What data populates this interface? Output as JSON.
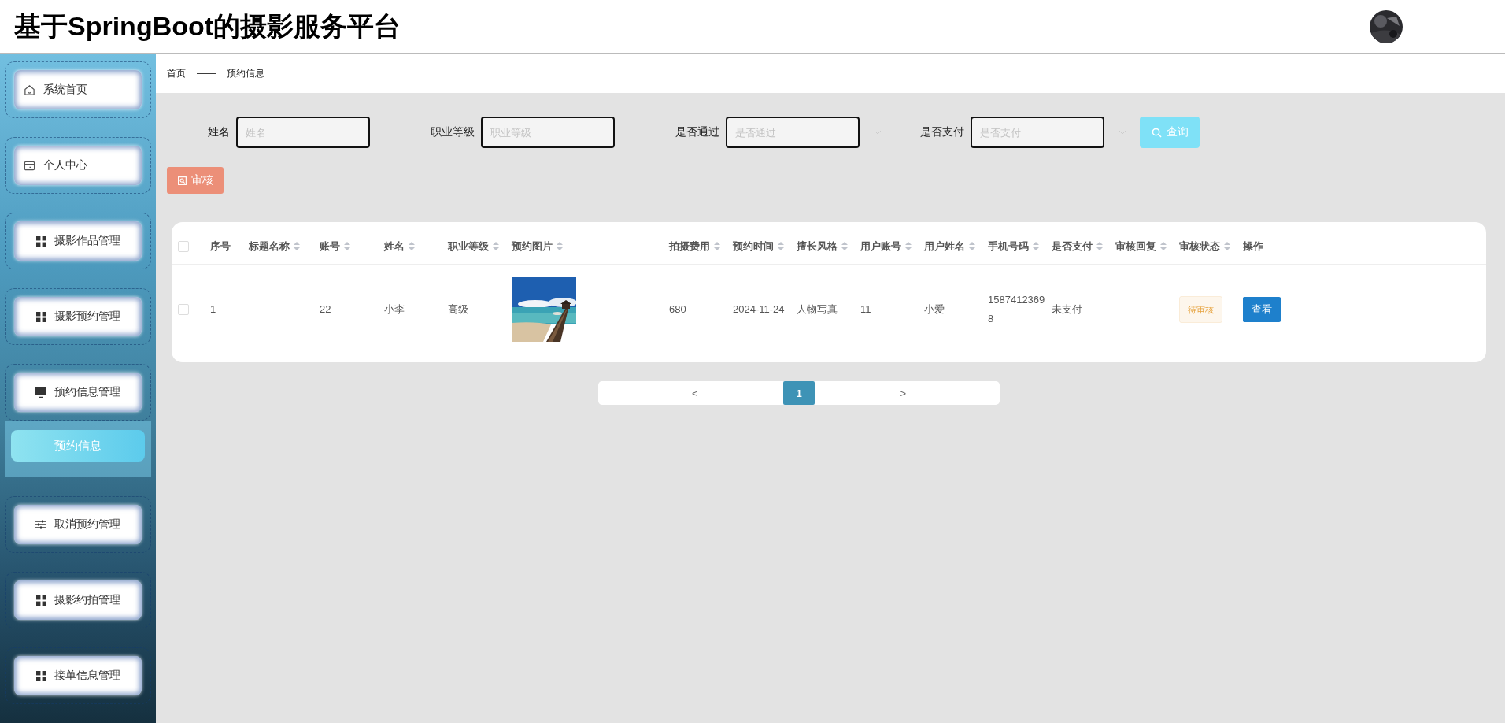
{
  "header": {
    "title": "基于SpringBoot的摄影服务平台",
    "avatar": {
      "kind": "picture"
    }
  },
  "breadcrumb": [
    "首页",
    "——",
    "预约信息"
  ],
  "sidebar": {
    "items": [
      {
        "label": "系统首页",
        "kind": "home"
      },
      {
        "label": "个人中心",
        "kind": "card"
      },
      {
        "label": "摄影作品管理",
        "kind": "grid"
      },
      {
        "label": "摄影预约管理",
        "kind": "grid"
      },
      {
        "label": "预约信息管理",
        "kind": "monitor",
        "children": [
          {
            "label": "预约信息",
            "selected": true
          }
        ]
      },
      {
        "label": "取消预约管理",
        "kind": "sliders"
      },
      {
        "label": "摄影约拍管理",
        "kind": "grid"
      },
      {
        "label": "接单信息管理",
        "kind": "grid"
      }
    ]
  },
  "filters": [
    {
      "label": "姓名",
      "placeholder": "姓名",
      "kind": "input"
    },
    {
      "label": "职业等级",
      "placeholder": "职业等级",
      "kind": "input"
    },
    {
      "label": "是否通过",
      "placeholder": "是否通过",
      "kind": "select"
    },
    {
      "label": "是否支付",
      "placeholder": "是否支付",
      "kind": "select"
    }
  ],
  "search_button": "查询",
  "audit_button": "审核",
  "table": {
    "header_checked": false,
    "columns": [
      {
        "label": "序号",
        "sortable": false
      },
      {
        "label": "标题名称",
        "sortable": true
      },
      {
        "label": "账号",
        "sortable": true
      },
      {
        "label": "姓名",
        "sortable": true
      },
      {
        "label": "职业等级",
        "sortable": true
      },
      {
        "label": "预约图片",
        "sortable": true
      },
      {
        "label": "拍摄费用",
        "sortable": true
      },
      {
        "label": "预约时间",
        "sortable": true
      },
      {
        "label": "擅长风格",
        "sortable": true
      },
      {
        "label": "用户账号",
        "sortable": true
      },
      {
        "label": "用户姓名",
        "sortable": true
      },
      {
        "label": "手机号码",
        "sortable": true
      },
      {
        "label": "是否支付",
        "sortable": true
      },
      {
        "label": "审核回复",
        "sortable": true
      },
      {
        "label": "审核状态",
        "sortable": true
      },
      {
        "label": "操作",
        "sortable": false
      }
    ],
    "rows": [
      {
        "checked": false,
        "cells": [
          {
            "kind": "text",
            "text": "1"
          },
          {
            "kind": "empty"
          },
          {
            "kind": "text",
            "text": "22"
          },
          {
            "kind": "text",
            "text": "小李"
          },
          {
            "kind": "text",
            "text": "高级"
          },
          {
            "kind": "picture"
          },
          {
            "kind": "text",
            "text": "680"
          },
          {
            "kind": "text",
            "text": "2024-11-24"
          },
          {
            "kind": "text",
            "text": "人物写真"
          },
          {
            "kind": "text",
            "text": "11"
          },
          {
            "kind": "text",
            "text": "小爱"
          },
          {
            "kind": "text",
            "text": "15874123698"
          },
          {
            "kind": "text",
            "text": "未支付"
          },
          {
            "kind": "empty"
          },
          {
            "kind": "tag",
            "text": "待审核"
          },
          {
            "kind": "button",
            "text": "查看"
          }
        ]
      }
    ]
  },
  "pagination": {
    "prev": "<",
    "next": ">",
    "pages": [
      {
        "label": "1",
        "selected": true
      }
    ]
  }
}
